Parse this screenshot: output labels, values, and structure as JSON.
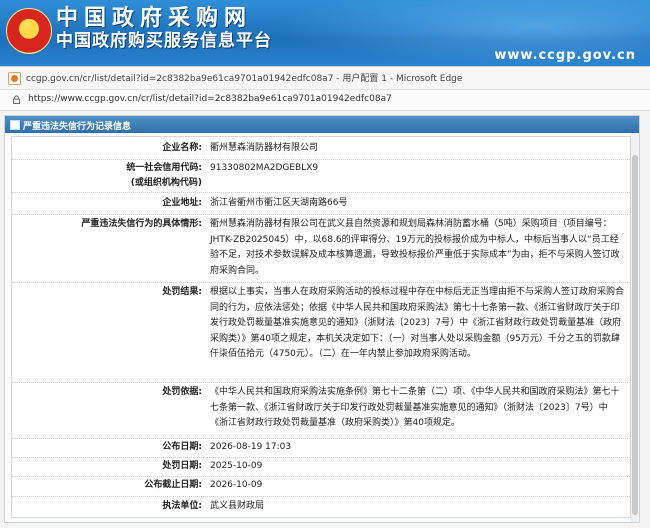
{
  "banner": {
    "title": "中国政府采购网",
    "subtitle": "中国政府购买服务信息平台",
    "url": "www.ccgp.gov.cn"
  },
  "window": {
    "title": "ccgp.gov.cn/cr/list/detail?id=2c8382ba9e61ca9701a01942edfc08a7 - 用户配置 1 - Microsoft Edge",
    "address": "https://www.ccgp.gov.cn/cr/list/detail?id=2c8382ba9e61ca9701a01942edfc08a7"
  },
  "panel": {
    "title": "严重违法失信行为记录信息"
  },
  "record": {
    "company_name_label": "企业名称:",
    "company_name": "衢州慧森消防器材有限公司",
    "credit_code_label": "统一社会信用代码:",
    "credit_code_label2": "(或组织机构代码)",
    "credit_code": "91330802MA2DGEBLX9",
    "address_label": "企业地址:",
    "address": "浙江省衢州市衢江区天湖南路66号",
    "situation_label": "严重违法失信行为的具体情形:",
    "situation": "衢州慧森消防器材有限公司在武义县自然资源和规划局森林消防蓄水桶（5吨）采购项目（项目编号：JHTK-ZB2025045）中，以68.6的评审得分、19万元的投标报价成为中标人，中标后当事人以“员工经验不足，对技术参数误解及成本核算遗漏，导致投标报价严重低于实际成本”为由，拒不与采购人签订政府采购合同。",
    "result_label": "处罚结果:",
    "result": "根据以上事实，当事人在政府采购活动的投标过程中存在中标后无正当理由拒不与采购人签订政府采购合同的行为，应依法惩处；依据《中华人民共和国政府采购法》第七十七条第一款、《浙江省财政厅关于印发行政处罚裁量基准实施意见的通知》（浙财法〔2023〕7号）中《浙江省财政行政处罚裁量基准（政府采购类）》第40项之规定，本机关决定如下：（一）对当事人处以采购金额（95万元）千分之五的罚款肆仟柒佰伍拾元（4750元）。（二）在一年内禁止参加政府采购活动。",
    "basis_label": "处罚依据:",
    "basis": "《中华人民共和国政府采购法实施条例》第七十二条第（二）项、《中华人民共和国政府采购法》第七十七条第一款、《浙江省财政厅关于印发行政处罚裁量基准实施意见的通知》（浙财法〔2023〕7号）中《浙江省财政行政处罚裁量基准（政府采购类）》第40项规定。",
    "publish_date_label": "公布日期:",
    "publish_date": "2026-08-19 17:03",
    "penalty_date_label": "处罚日期:",
    "penalty_date": "2025-10-09",
    "deadline_label": "公布截止日期:",
    "deadline": "2026-10-09",
    "agency_label": "执法单位:",
    "agency": "武义县财政局"
  }
}
